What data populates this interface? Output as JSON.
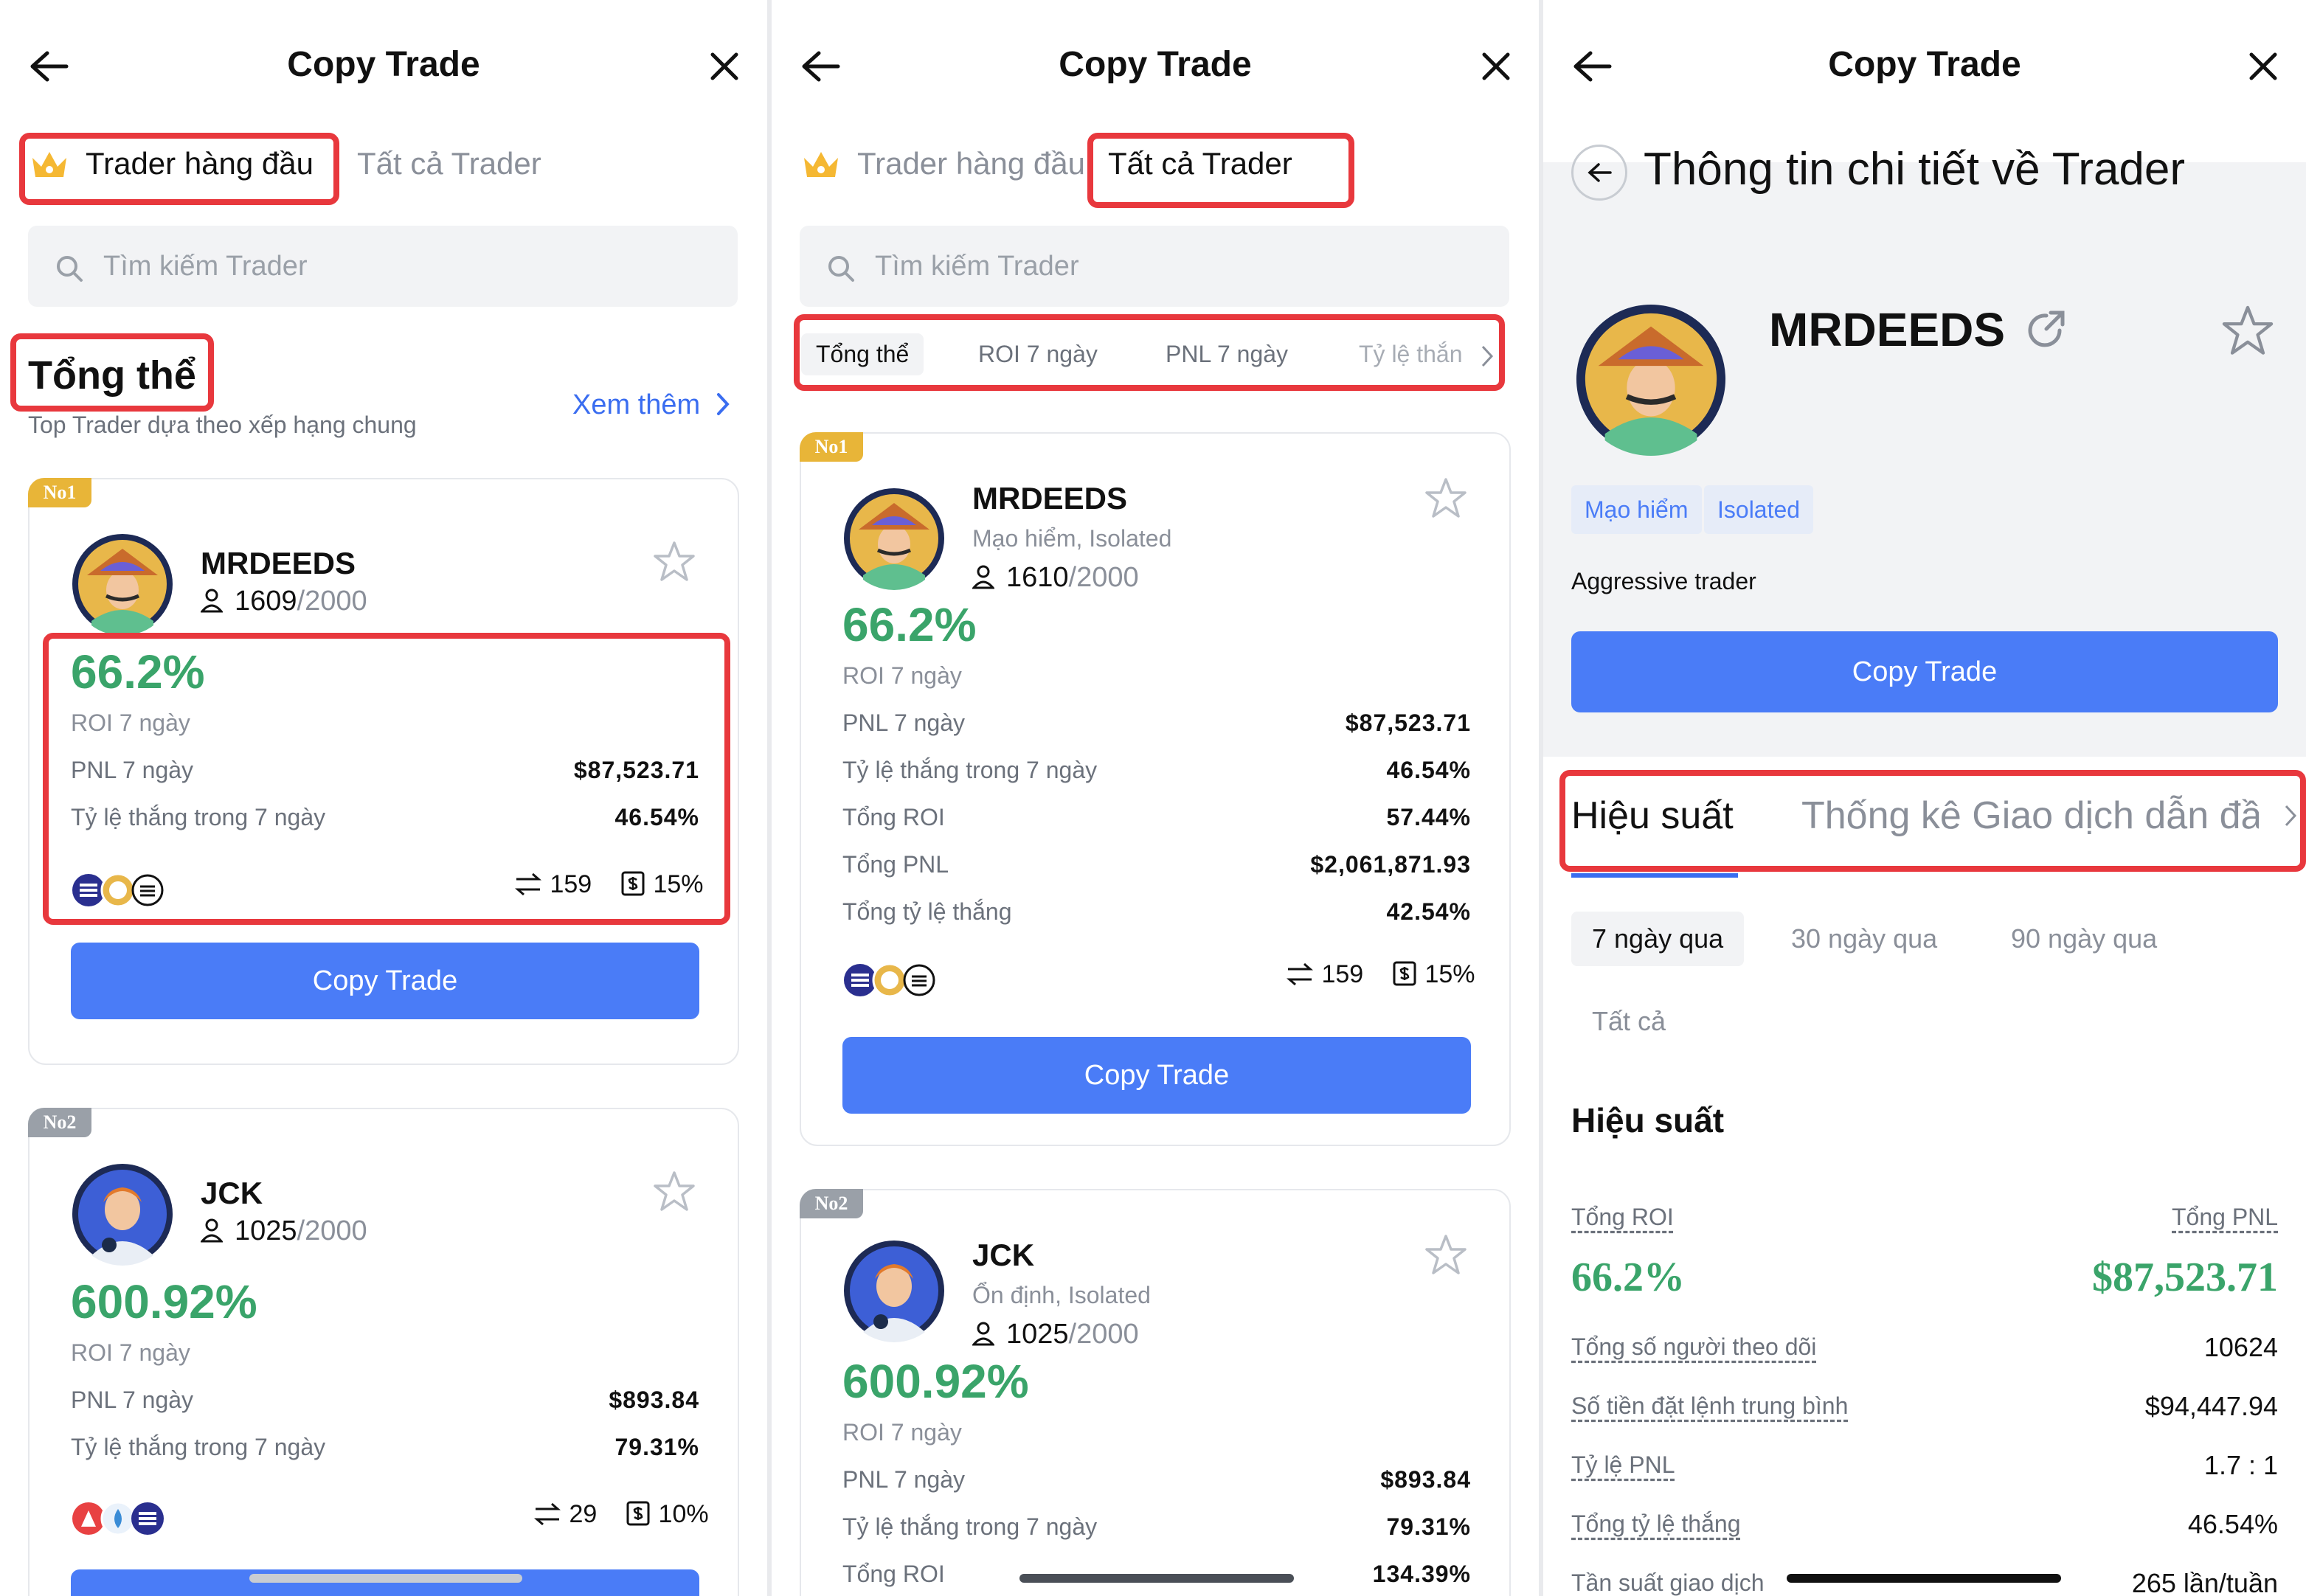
{
  "header": {
    "title": "Copy Trade"
  },
  "tabs": {
    "top_traders": "Trader hàng đầu",
    "all_traders": "Tất cả Trader"
  },
  "search": {
    "placeholder": "Tìm kiếm Trader"
  },
  "overview": {
    "title": "Tổng thể",
    "subtitle": "Top Trader dựa theo xếp hạng chung",
    "see_more": "Xem thêm"
  },
  "filters": [
    "Tổng thể",
    "ROI 7 ngày",
    "PNL 7 ngày",
    "Tỷ lệ thắn"
  ],
  "labels": {
    "roi_7d": "ROI 7 ngày",
    "pnl_7d": "PNL 7 ngày",
    "win_rate_7d": "Tỷ lệ thắng trong 7 ngày",
    "total_roi": "Tổng ROI",
    "total_pnl": "Tổng PNL",
    "total_win_rate": "Tổng tỷ lệ thắng",
    "copy_button": "Copy Trade"
  },
  "traders": [
    {
      "rank": "No1",
      "name": "MRDEEDS",
      "tags": "Mạo hiểm, Isolated",
      "followers_p1": "1609",
      "followers_p2": "1610",
      "followers_max": "/2000",
      "roi": "66.2%",
      "pnl_7d": "$87,523.71",
      "win_rate_7d": "46.54%",
      "total_roi": "57.44%",
      "total_pnl": "$2,061,871.93",
      "total_win_rate": "42.54%",
      "trades": "159",
      "share": "15%"
    },
    {
      "rank": "No2",
      "name": "JCK",
      "tags": "Ổn định, Isolated",
      "followers_p1": "1025",
      "followers_p2": "1025",
      "followers_max": "/2000",
      "roi": "600.92%",
      "pnl_7d": "$893.84",
      "win_rate_7d": "79.31%",
      "total_roi": "134.39%",
      "trades": "29",
      "share": "10%"
    }
  ],
  "detail": {
    "title": "Thông tin chi tiết về Trader",
    "name": "MRDEEDS",
    "tags": [
      "Mạo hiểm",
      "Isolated"
    ],
    "description": "Aggressive trader",
    "copy_button": "Copy Trade",
    "tabs": [
      "Hiệu suất",
      "Thống kê Giao dịch dẫn đầ"
    ],
    "ranges": [
      "7 ngày qua",
      "30 ngày qua",
      "90 ngày qua",
      "Tất cả"
    ],
    "section_title": "Hiệu suất",
    "total_roi_label": "Tổng ROI",
    "total_pnl_label": "Tổng PNL",
    "total_roi": "66.2%",
    "total_pnl": "$87,523.71",
    "stats": [
      {
        "label": "Tổng số người theo dõi",
        "value": "10624"
      },
      {
        "label": "Số tiền đặt lệnh trung bình",
        "value": "$94,447.94"
      },
      {
        "label": "Tỷ lệ PNL",
        "value": "1.7 : 1"
      },
      {
        "label": "Tổng tỷ lệ thắng",
        "value": "46.54%"
      },
      {
        "label": "Tần suất giao dịch",
        "value": "265 lần/tuần"
      }
    ]
  },
  "colors": {
    "accent": "#4a7cf7",
    "positive": "#3aa46a",
    "highlight": "#e8383d",
    "rank_gold": "#e8b538"
  }
}
